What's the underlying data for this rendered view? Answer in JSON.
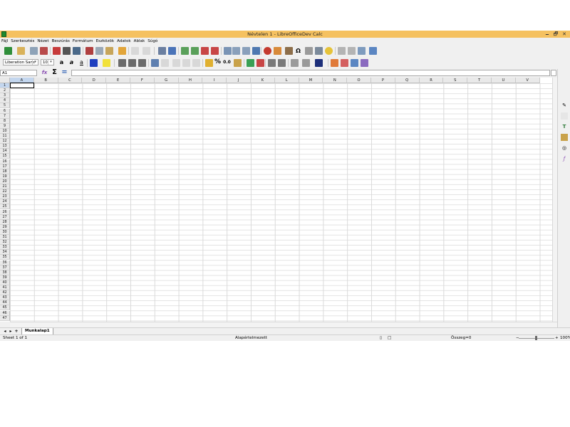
{
  "window": {
    "title": "Névtelen 1 - LibreOfficeDev Calc",
    "buttons": [
      "🗕",
      "🗗",
      "✕"
    ]
  },
  "menu": [
    "Fájl",
    "Szerkesztés",
    "Nézet",
    "Beszúrás",
    "Formátum",
    "Eszközök",
    "Adatok",
    "Ablak",
    "Súgó"
  ],
  "formatting": {
    "font_name": "Liberation Sans",
    "font_size": "10",
    "bold_glyph": "a",
    "italic_glyph": "a",
    "underline_glyph": "a",
    "percent_glyph": "%",
    "decimal_glyph": "0.0",
    "special_char_glyph": "Ω"
  },
  "formula_bar": {
    "cell_ref": "A1",
    "function_glyph": "fx",
    "sum_glyph": "Σ",
    "equals_glyph": "=",
    "content": ""
  },
  "grid": {
    "columns": [
      "A",
      "B",
      "C",
      "D",
      "E",
      "F",
      "G",
      "H",
      "I",
      "J",
      "K",
      "L",
      "M",
      "N",
      "O",
      "P",
      "Q",
      "R",
      "S",
      "T",
      "U",
      "V"
    ],
    "rows": [
      "1",
      "2",
      "3",
      "4",
      "5",
      "6",
      "7",
      "8",
      "9",
      "10",
      "11",
      "12",
      "13",
      "14",
      "15",
      "16",
      "17",
      "18",
      "19",
      "20",
      "21",
      "22",
      "23",
      "24",
      "25",
      "26",
      "27",
      "28",
      "29",
      "30",
      "31",
      "32",
      "33",
      "34",
      "35",
      "36",
      "37",
      "38",
      "39",
      "40",
      "41",
      "42",
      "43",
      "44",
      "45",
      "46",
      "47"
    ],
    "selected_col": "A",
    "selected_row": "1"
  },
  "sheet_tabs": {
    "active": "Munkalap1",
    "nav": [
      "◂",
      "▸",
      "+"
    ]
  },
  "status": {
    "sheet_info": "Sheet 1 of 1",
    "page_style": "Alapértelmezett",
    "sum_label": "Összeg=0",
    "zoom": "100%"
  },
  "colors": {
    "titlebar": "#f5c160",
    "selection": "#c3d6ee"
  }
}
